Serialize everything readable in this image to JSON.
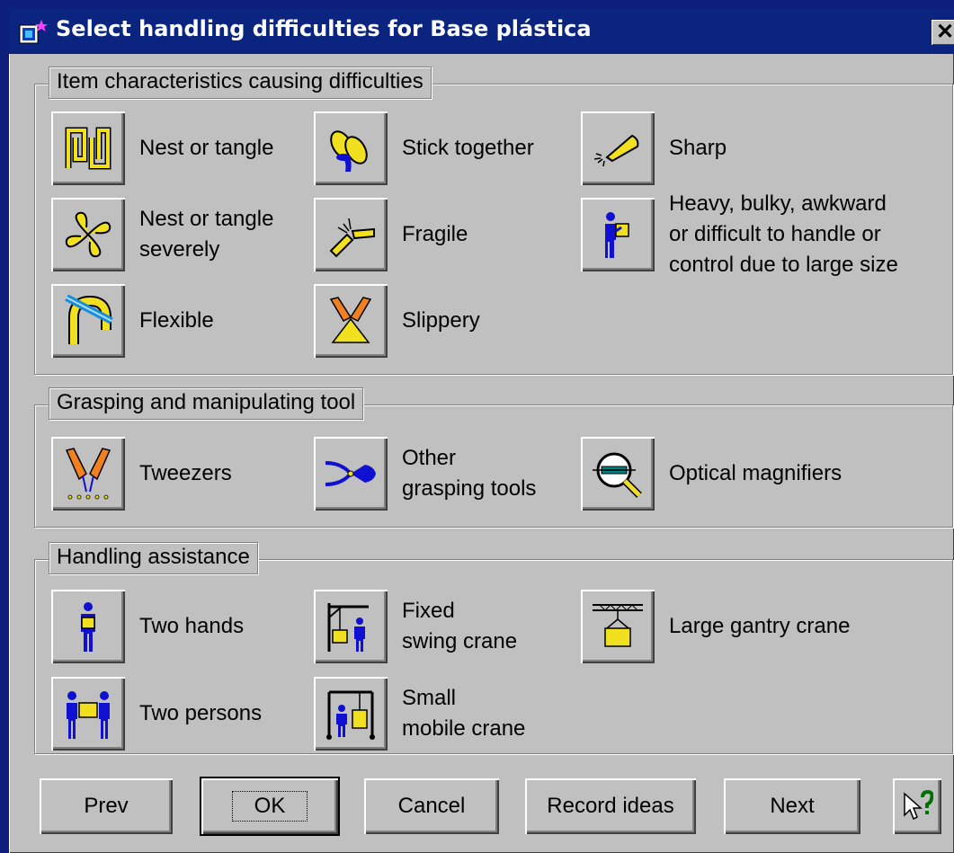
{
  "window": {
    "title": "Select handling difficulties for Base plástica",
    "close_label": "✕"
  },
  "groups": {
    "characteristics": {
      "label": "Item characteristics causing difficulties",
      "items": [
        {
          "label": "Nest or tangle",
          "icon": "nest-tangle-icon"
        },
        {
          "label": "Stick together",
          "icon": "stick-together-icon"
        },
        {
          "label": "Sharp",
          "icon": "sharp-icon"
        },
        {
          "label": "Nest or tangle\nseverely",
          "icon": "nest-tangle-severely-icon"
        },
        {
          "label": "Fragile",
          "icon": "fragile-icon"
        },
        {
          "label": "Heavy, bulky, awkward\nor difficult to handle or\ncontrol due to large size",
          "icon": "heavy-bulky-icon"
        },
        {
          "label": "Flexible",
          "icon": "flexible-icon"
        },
        {
          "label": "Slippery",
          "icon": "slippery-icon"
        }
      ]
    },
    "tools": {
      "label": "Grasping and manipulating tool",
      "items": [
        {
          "label": "Tweezers",
          "icon": "tweezers-icon"
        },
        {
          "label": "Other\ngrasping tools",
          "icon": "pliers-icon"
        },
        {
          "label": "Optical magnifiers",
          "icon": "magnifier-icon"
        }
      ]
    },
    "assistance": {
      "label": "Handling assistance",
      "items": [
        {
          "label": "Two hands",
          "icon": "two-hands-icon"
        },
        {
          "label": "Fixed\nswing crane",
          "icon": "swing-crane-icon"
        },
        {
          "label": "Large gantry crane",
          "icon": "gantry-crane-icon"
        },
        {
          "label": "Two persons",
          "icon": "two-persons-icon"
        },
        {
          "label": "Small\nmobile crane",
          "icon": "mobile-crane-icon"
        }
      ]
    }
  },
  "buttons": {
    "prev": "Prev",
    "ok": "OK",
    "cancel": "Cancel",
    "record": "Record ideas",
    "next": "Next"
  },
  "colors": {
    "desktop": "#0d1f7a",
    "titlebar": "#0a2480",
    "face": "#c0c0c0",
    "icon_yellow": "#f0e020",
    "icon_blue": "#1010d0"
  }
}
